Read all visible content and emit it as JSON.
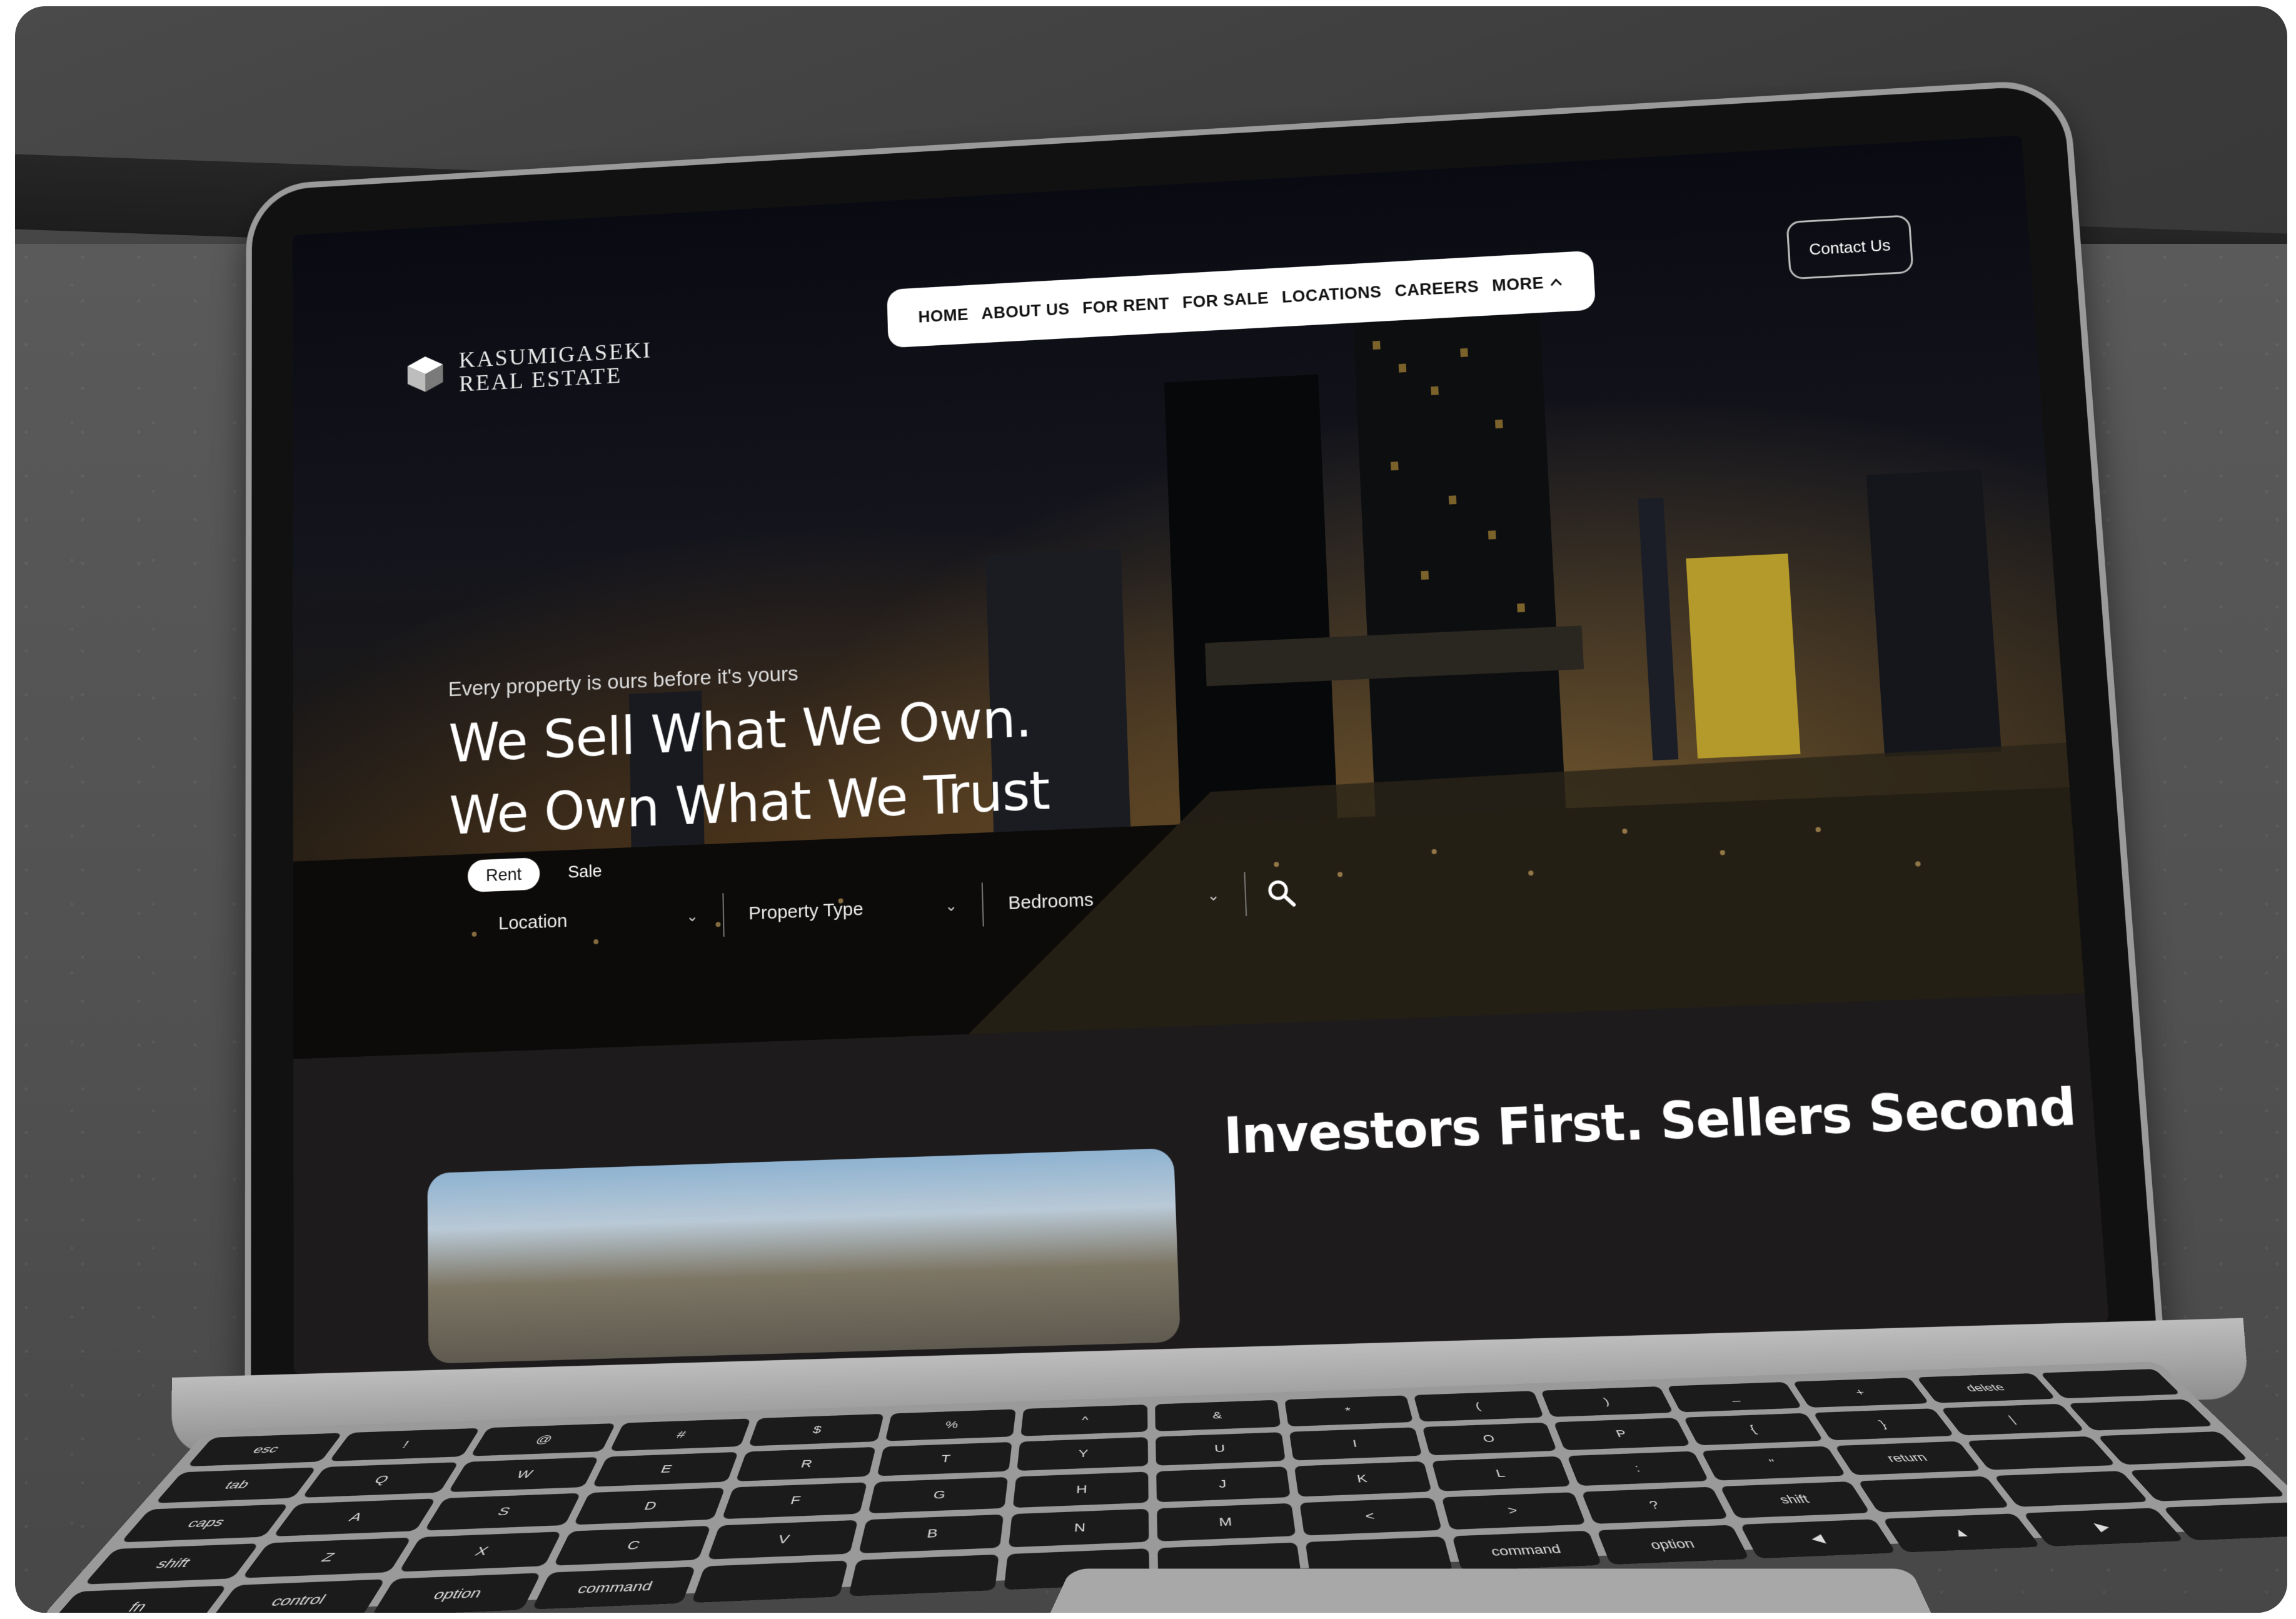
{
  "brand": {
    "line1": "KASUMIGASEKI",
    "line2": "REAL ESTATE"
  },
  "nav": {
    "items": [
      "HOME",
      "ABOUT US",
      "FOR RENT",
      "FOR SALE",
      "LOCATIONS",
      "CAREERS"
    ],
    "more_label": "MORE"
  },
  "contact_label": "Contact Us",
  "hero": {
    "tagline": "Every property is ours before it's yours",
    "headline_line1": "We Sell What We Own.",
    "headline_line2": "We Own What We Trust"
  },
  "search": {
    "modes": [
      "Rent",
      "Sale"
    ],
    "active_mode": "Rent",
    "filters": [
      "Location",
      "Property Type",
      "Bedrooms"
    ]
  },
  "section": {
    "title": "Investors First. Sellers Second"
  },
  "keyboard": {
    "keys": [
      "esc",
      "!",
      "@",
      "#",
      "$",
      "%",
      "^",
      "&",
      "*",
      "(",
      ")",
      "_",
      "+",
      "delete",
      "",
      "tab",
      "Q",
      "W",
      "E",
      "R",
      "T",
      "Y",
      "U",
      "I",
      "O",
      "P",
      "{",
      "}",
      "|",
      "",
      "caps",
      "A",
      "S",
      "D",
      "F",
      "G",
      "H",
      "J",
      "K",
      "L",
      ":",
      "\"",
      "return",
      "",
      "",
      "shift",
      "Z",
      "X",
      "C",
      "V",
      "B",
      "N",
      "M",
      "<",
      ">",
      "?",
      "shift",
      "",
      "",
      "",
      "fn",
      "control",
      "option",
      "command",
      "",
      "",
      "",
      "",
      "",
      "command",
      "option",
      "◀",
      "▲",
      "▶",
      ""
    ]
  }
}
